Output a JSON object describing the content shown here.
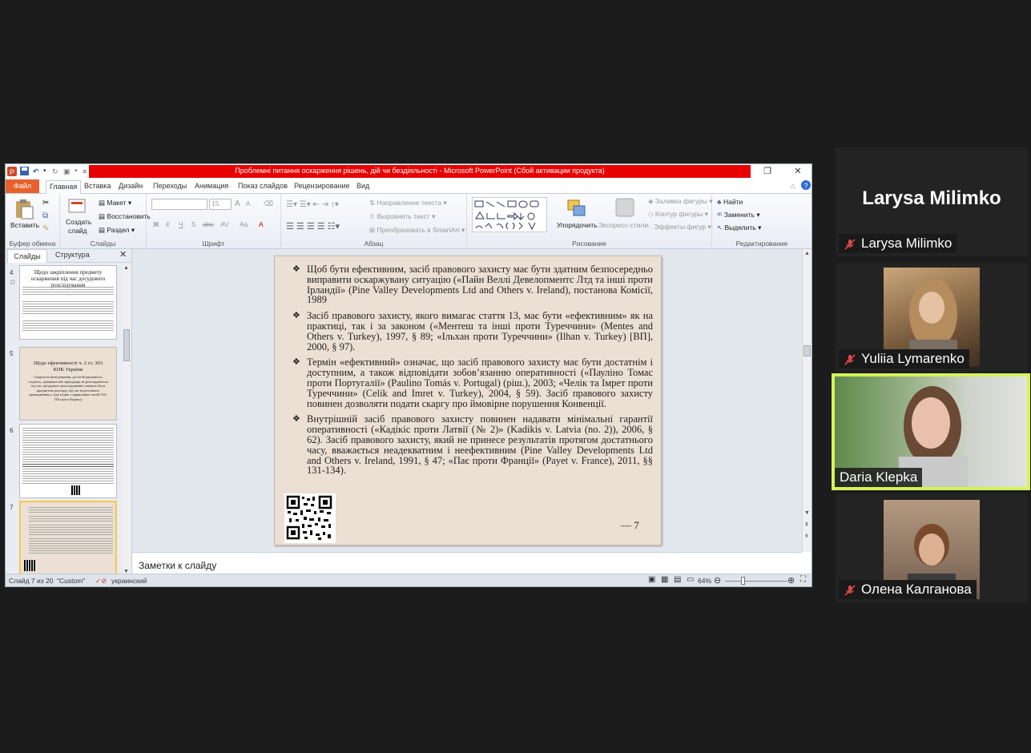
{
  "window": {
    "title": "Проблемні питання оскарження рішень, дій чи бездіяльності  -  Microsoft PowerPoint (Сбой активации продукта)"
  },
  "ribbon_tabs": [
    "Файл",
    "Главная",
    "Вставка",
    "Дизайн",
    "Переходы",
    "Анимация",
    "Показ слайдов",
    "Рецензирование",
    "Вид"
  ],
  "ribbon": {
    "clipboard": {
      "label": "Буфер обмена",
      "paste": "Вставить"
    },
    "slides": {
      "label": "Слайды",
      "new_slide": "Создать",
      "new_slide2": "слайд",
      "layout": "Макет",
      "reset": "Восстановить",
      "section": "Раздел"
    },
    "font": {
      "label": "Шрифт",
      "size": "15",
      "bold": "Ж",
      "italic": "К",
      "underline": "Ч",
      "strike": "S",
      "shadow": "abc",
      "spacing": "AV",
      "case": "Aa",
      "grow": "A",
      "shrink": "A"
    },
    "paragraph": {
      "label": "Абзац",
      "text_direction": "Направление текста",
      "align_text": "Выровнять текст",
      "smartart": "Преобразовать в SmartArt"
    },
    "drawing": {
      "label": "Рисование",
      "arrange": "Упорядочить",
      "quick_styles": "Экспресс-стили",
      "fill": "Заливка фигуры",
      "outline": "Контур фигуры",
      "effects": "Эффекты фигур"
    },
    "editing": {
      "label": "Редактирование",
      "find": "Найти",
      "replace": "Заменить",
      "select": "Выделить"
    }
  },
  "left_panel": {
    "tab_slides": "Слайды",
    "tab_outline": "Структура",
    "thumbs": [
      {
        "num": "4",
        "title": "Щодо закріплення предмету оскарження під час досудового розслідування"
      },
      {
        "num": "5",
        "title": "Щодо ефективності ч. 2 ст. 303 КПК України",
        "body": "Скарги на інші рішення, дії чи бездіяльність слідчого, дізнавача або прокурора не розглядаються під час досудового розслідування і можуть бути предметом розгляду під час підготовчого провадження у суді згідно з правилами статей 314-316 цього Кодексу"
      },
      {
        "num": "6"
      },
      {
        "num": "7"
      }
    ]
  },
  "slide": {
    "bullets": [
      "Щоб бути ефективним, засіб правового захисту має бути здатним безпосередньо виправити оскаржувану ситуацію («Пайн Веллі Девелопментс Лтд та інші проти Ірландії» (Pine Valley Developments Ltd and Others v. Ireland), постанова Комісії, 1989",
      "Засіб правового захисту, якого вимагає стаття 13, має бути «ефективним» як на практиці, так і за законом («Ментеш та інші проти Туреччини» (Mentes and Others v. Turkey), 1997, § 89; «Ільхан проти Туреччини» (Ilhan v. Turkey) [ВП], 2000, § 97).",
      "Термін «ефективний» означає, що засіб правового захисту має бути достатнім і доступним, а також відповідати зобов’язанню оперативності («Пауліно Томас проти Португалії» (Paulino Tomás v. Portugal) (ріш.), 2003; «Челік та Імрет проти Туреччини» (Celik and Imret v. Turkey), 2004, § 59). Засіб правового захисту повинен дозволяти подати скаргу про ймовірне порушення Конвенції.",
      "Внутрішній засіб правового захисту повинен надавати мінімальні гарантії оперативності («Кадікіс проти Латвії (№ 2)» (Kadikis v. Latvia (no. 2)), 2006, § 62). Засіб правового захисту, який не принесе результатів протягом достатнього часу, вважається неадекватним і неефективним (Pine Valley Developments Ltd and Others v. Ireland, 1991, § 47; «Пає проти Франції» (Payet v. France), 2011, §§ 131-134)."
    ],
    "page_number": "— 7"
  },
  "notes_placeholder": "Заметки к слайду",
  "status": {
    "slide_counter": "Слайд 7 из 20",
    "theme": "\"Custom\"",
    "language": "украинский",
    "zoom": "64%"
  },
  "participants": [
    {
      "name": "Larysa Milimko",
      "muted": true,
      "video": false
    },
    {
      "name": "Yuliia Lymarenko",
      "muted": true,
      "video": true
    },
    {
      "name": "Daria Klepka",
      "muted": false,
      "video": true,
      "speaking": true
    },
    {
      "name": "Олена Калганова",
      "muted": true,
      "video": true
    }
  ],
  "colors": {
    "active_speaker": "#d6f25a",
    "file_tab": "#e8602c",
    "title_bar": "#e60000",
    "mic_muted": "#e04848"
  }
}
